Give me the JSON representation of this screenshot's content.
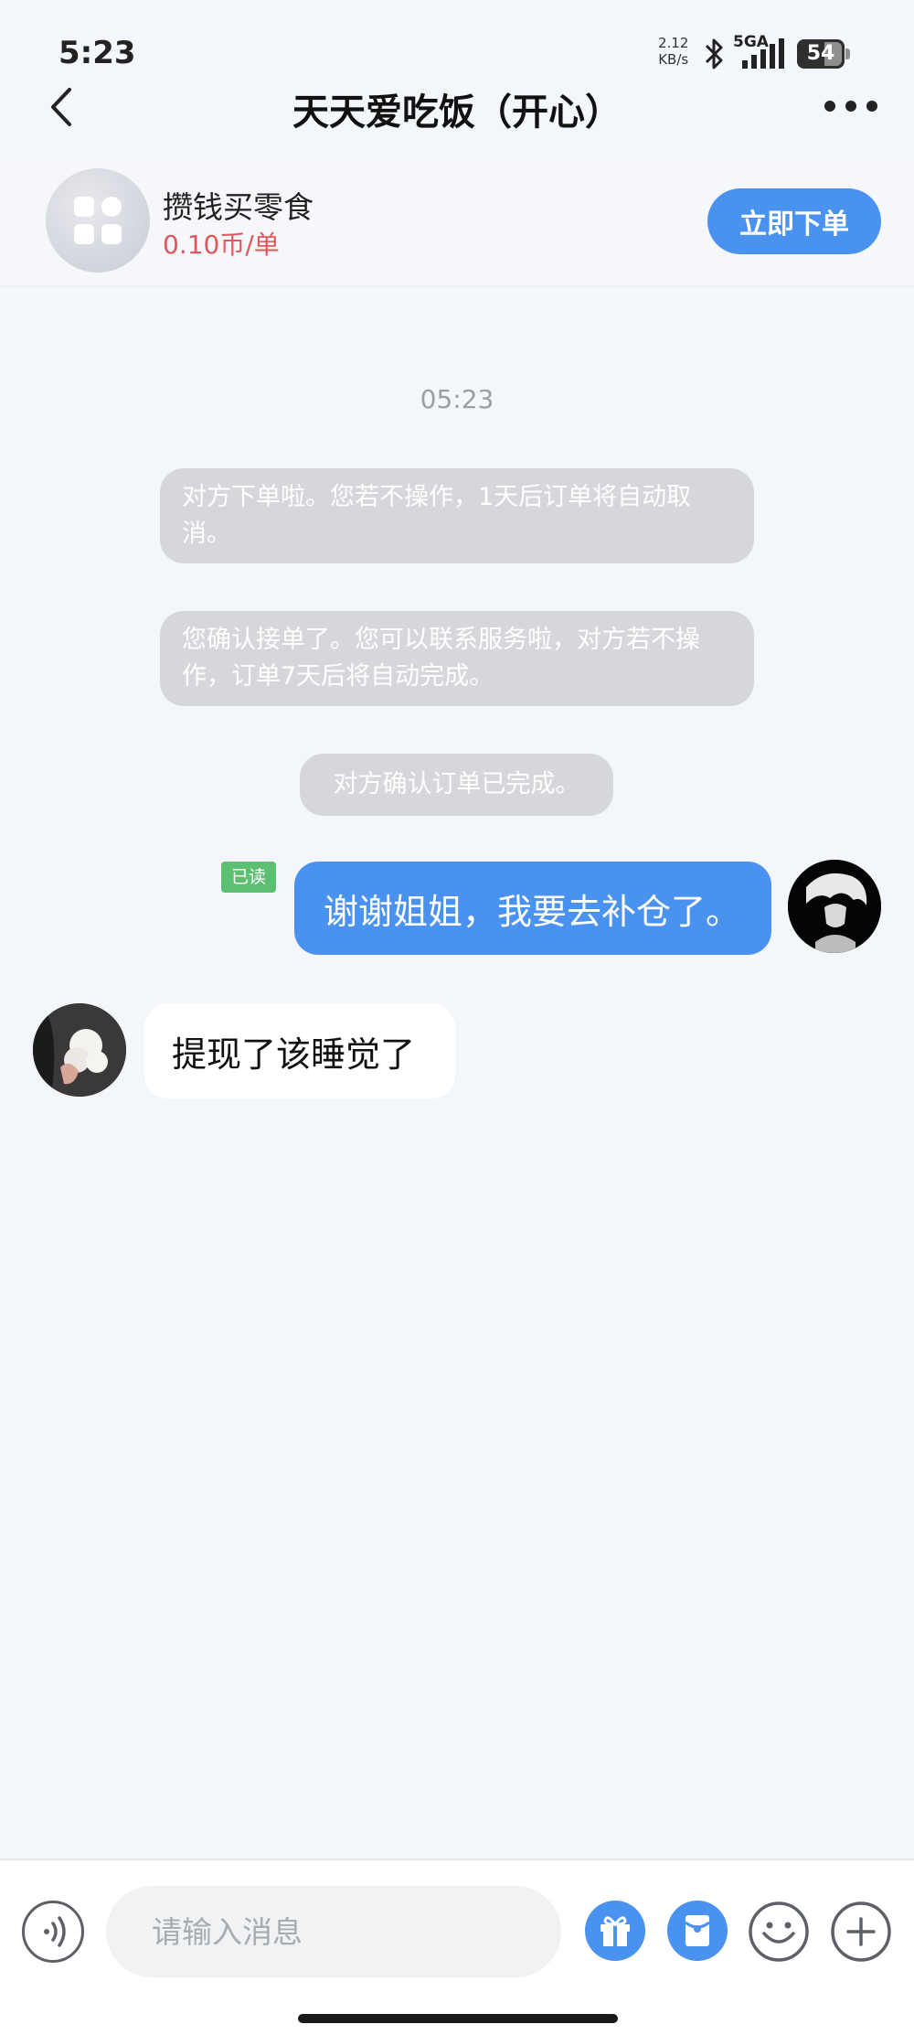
{
  "status_bar": {
    "time": "5:23",
    "net_speed_value": "2.12",
    "net_speed_unit": "KB/s",
    "network": "5GA",
    "battery": "54"
  },
  "header": {
    "title": "天天爱吃饭（开心）"
  },
  "product": {
    "name": "攒钱买零食",
    "price": "0.10币/单",
    "order_button": "立即下单"
  },
  "chat": {
    "timestamp": "05:23",
    "system_messages": [
      "对方下单啦。您若不操作，1天后订单将自动取消。",
      "您确认接单了。您可以联系服务啦，对方若不操作，订单7天后将自动完成。",
      "对方确认订单已完成。"
    ],
    "outgoing": {
      "read_status": "已读",
      "text": "谢谢姐姐，我要去补仓了。"
    },
    "incoming": {
      "text": "提现了该睡觉了"
    }
  },
  "input_bar": {
    "placeholder": "请输入消息"
  },
  "colors": {
    "accent": "#4a92f0",
    "price": "#e0585b",
    "read_badge": "#5cbf72",
    "system_bubble": "#d5d7da",
    "background": "#f3f6fa"
  },
  "icons": [
    "back-icon",
    "more-icon",
    "grid-icon",
    "bluetooth-icon",
    "signal-icon",
    "battery-icon",
    "voice-icon",
    "gift-icon",
    "red-packet-icon",
    "emoji-icon",
    "plus-icon"
  ]
}
